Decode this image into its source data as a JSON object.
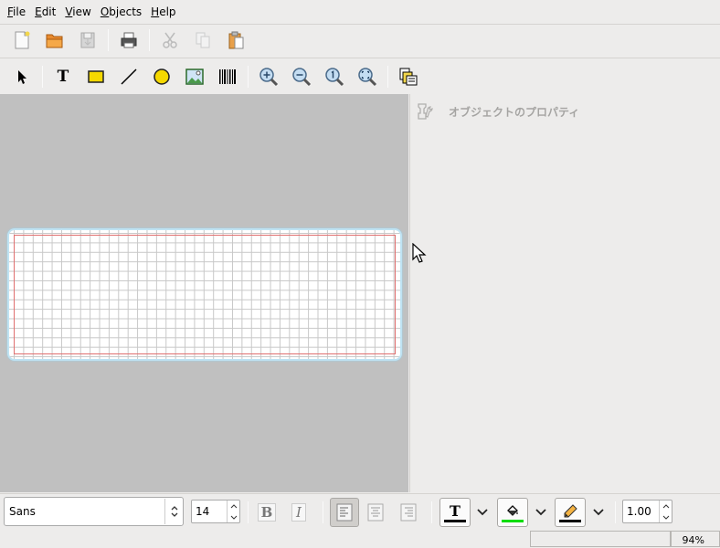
{
  "menubar": {
    "items": [
      {
        "acc": "F",
        "rest": "ile"
      },
      {
        "acc": "E",
        "rest": "dit"
      },
      {
        "acc": "V",
        "rest": "iew"
      },
      {
        "acc": "O",
        "rest": "bjects"
      },
      {
        "acc": "H",
        "rest": "elp"
      }
    ]
  },
  "toolbar_main": {
    "icons": [
      "new-file-icon",
      "open-folder-icon",
      "save-icon",
      "print-icon",
      "cut-icon",
      "copy-icon",
      "paste-icon"
    ]
  },
  "toolbar_objects": {
    "text_tool_glyph": "T",
    "icons": [
      "arrow-select-icon",
      "text-tool-icon",
      "box-tool-icon",
      "line-tool-icon",
      "ellipse-tool-icon",
      "image-tool-icon",
      "barcode-tool-icon",
      "zoom-in-icon",
      "zoom-out-icon",
      "zoom-1to1-icon",
      "zoom-fit-icon",
      "merge-properties-icon"
    ]
  },
  "properties": {
    "title": "オブジェクトのプロパティ"
  },
  "format_toolbar": {
    "font_family": "Sans",
    "font_size": "14",
    "bold_glyph": "B",
    "italic_glyph": "I",
    "text_color_glyph": "T",
    "line_width": "1.00",
    "colors": {
      "text": "#000000",
      "fill": "#00dd00",
      "line": "#000000"
    }
  },
  "statusbar": {
    "zoom": "94%"
  }
}
